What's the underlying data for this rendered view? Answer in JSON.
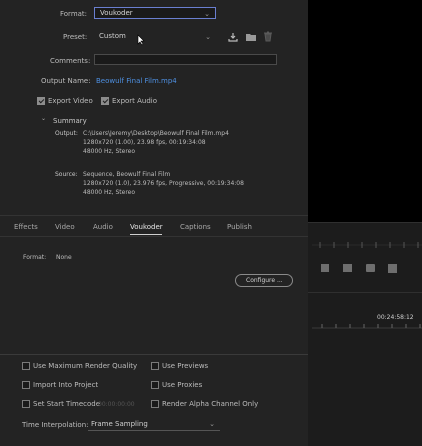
{
  "export": {
    "format_label": "Format:",
    "format_value": "Voukoder",
    "preset_label": "Preset:",
    "preset_value": "Custom",
    "comments_label": "Comments:",
    "output_name_label": "Output Name:",
    "output_name_value": "Beowulf Final Film.mp4",
    "export_video_label": "Export Video",
    "export_audio_label": "Export Audio",
    "summary_title": "Summary",
    "output_label": "Output:",
    "output_lines": [
      "C:\\Users\\Jeremy\\Desktop\\Beowulf Final Film.mp4",
      "1280x720 (1.00), 23.98 fps, 00:19:34:08",
      "48000 Hz, Stereo"
    ],
    "source_label": "Source:",
    "source_lines": [
      "Sequence, Beowulf Final Film",
      "1280x720 (1.0), 23.976 fps, Progressive, 00:19:34:08",
      "48000 Hz, Stereo"
    ]
  },
  "tabs": [
    {
      "label": "Effects",
      "active": false
    },
    {
      "label": "Video",
      "active": false
    },
    {
      "label": "Audio",
      "active": false
    },
    {
      "label": "Voukoder",
      "active": true
    },
    {
      "label": "Captions",
      "active": false
    },
    {
      "label": "Publish",
      "active": false
    }
  ],
  "voukoder_panel": {
    "format_label": "Format:",
    "format_value": "None",
    "configure_label": "Configure ..."
  },
  "options": {
    "max_render_quality": "Use Maximum Render Quality",
    "use_previews": "Use Previews",
    "import_into_project": "Import Into Project",
    "use_proxies": "Use Proxies",
    "set_start_timecode": "Set Start Timecode",
    "timecode_value": "00:00:00:00",
    "render_alpha": "Render Alpha Channel Only",
    "time_interpolation_label": "Time Interpolation:",
    "time_interpolation_value": "Frame Sampling"
  },
  "timeline": {
    "timecode": "00:24:58:12"
  },
  "colors": {
    "accent_blue": "#4e8fe0",
    "focus_border": "#6a7fd0",
    "dialog_bg": "#232323"
  }
}
